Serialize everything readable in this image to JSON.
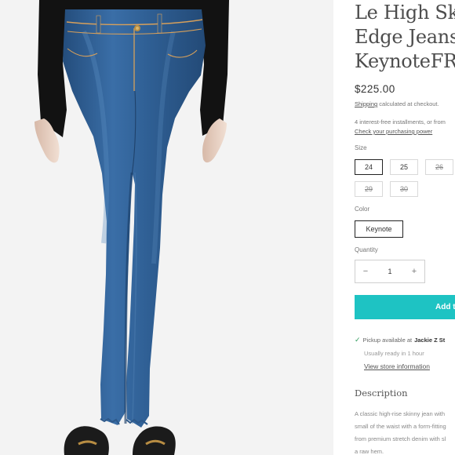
{
  "product": {
    "title": "Le High Sk\nEdge Jeans\nKeynoteFR",
    "price": "$225.00",
    "shipping_link": "Shipping",
    "shipping_rest": " calculated at checkout.",
    "installments": "4 interest-free installments, or from",
    "installments_link": "Check your purchasing power",
    "size_label": "Size",
    "sizes": [
      {
        "label": "24",
        "state": "selected"
      },
      {
        "label": "25",
        "state": "available"
      },
      {
        "label": "26",
        "state": "soldout"
      },
      {
        "label": "29",
        "state": "soldout"
      },
      {
        "label": "30",
        "state": "soldout"
      }
    ],
    "color_label": "Color",
    "color_value": "Keynote",
    "quantity_label": "Quantity",
    "quantity_value": "1",
    "qty_minus": "−",
    "qty_plus": "+",
    "add_button": "Add t",
    "pickup_prefix": "Pickup available at ",
    "pickup_store": "Jackie Z St",
    "ready_note": "Usually ready in 1 hour",
    "store_link": "View store information",
    "description_heading": "Description",
    "description_text": "A classic high-rise skinny jean with\nsmall of the waist with a form-fitting\nfrom premium stretch denim with sl\na raw hem."
  },
  "icons": {
    "check": "check-icon"
  },
  "colors": {
    "accent": "#1ec3c3",
    "denim": "#2f5f94",
    "top": "#151515"
  }
}
